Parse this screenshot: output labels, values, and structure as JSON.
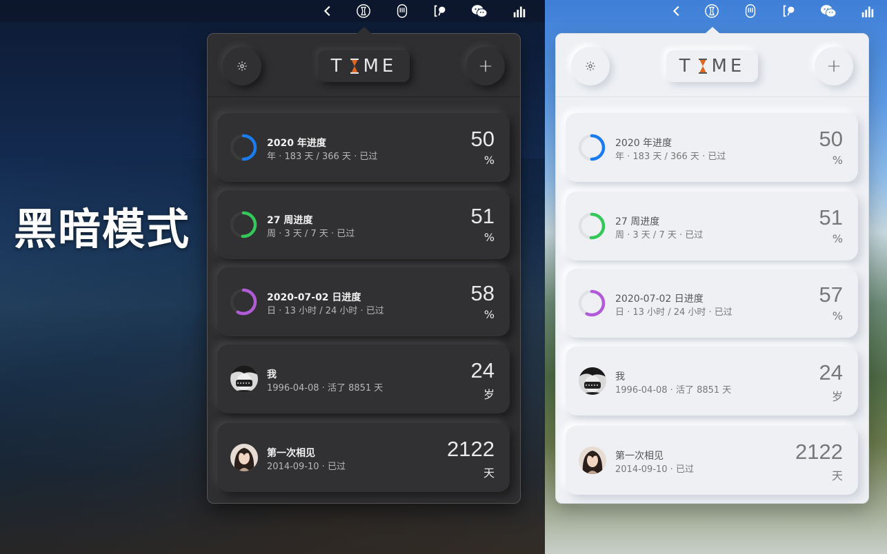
{
  "watermark": "黑暗模式",
  "logo": {
    "left": "T",
    "right": "ME"
  },
  "menubar_icons": [
    "chevron-left-icon",
    "hourglass-icon",
    "mouse-icon",
    "bracket-pin-icon",
    "wechat-icon",
    "signal-bars-icon"
  ],
  "colors": {
    "blue": "#1a7cf0",
    "green": "#34c759",
    "purple": "#b25bd9",
    "hourglass": "#e2651d"
  },
  "dark": {
    "cards": [
      {
        "title": "2020 年进度",
        "subtitle": "年 · 183 天 / 366 天 · 已过",
        "value": "50",
        "unit": "%",
        "progress": 0.5,
        "color": "#1a7cf0"
      },
      {
        "title": "27 周进度",
        "subtitle": "周 · 3 天 / 7 天 · 已过",
        "value": "51",
        "unit": "%",
        "progress": 0.51,
        "color": "#34c759"
      },
      {
        "title": "2020-07-02 日进度",
        "subtitle": "日 · 13 小时 / 24 小时 · 已过",
        "value": "58",
        "unit": "%",
        "progress": 0.58,
        "color": "#b25bd9"
      },
      {
        "title": "我",
        "subtitle": "1996-04-08 · 活了 8851 天",
        "value": "24",
        "unit": "岁"
      },
      {
        "title": "第一次相见",
        "subtitle": "2014-09-10 · 已过",
        "value": "2122",
        "unit": "天"
      }
    ]
  },
  "light": {
    "cards": [
      {
        "title": "2020 年进度",
        "subtitle": "年 · 183 天 / 366 天 · 已过",
        "value": "50",
        "unit": "%",
        "progress": 0.5,
        "color": "#1a7cf0"
      },
      {
        "title": "27 周进度",
        "subtitle": "周 · 3 天 / 7 天 · 已过",
        "value": "51",
        "unit": "%",
        "progress": 0.51,
        "color": "#34c759"
      },
      {
        "title": "2020-07-02 日进度",
        "subtitle": "日 · 13 小时 / 24 小时 · 已过",
        "value": "57",
        "unit": "%",
        "progress": 0.57,
        "color": "#b25bd9"
      },
      {
        "title": "我",
        "subtitle": "1996-04-08 · 活了 8851 天",
        "value": "24",
        "unit": "岁"
      },
      {
        "title": "第一次相见",
        "subtitle": "2014-09-10 · 已过",
        "value": "2122",
        "unit": "天"
      }
    ]
  }
}
